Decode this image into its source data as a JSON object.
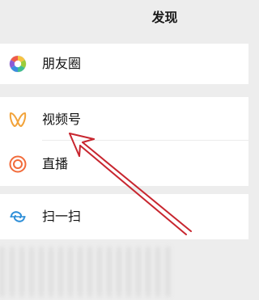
{
  "header": {
    "title": "发现"
  },
  "menu": {
    "moments": {
      "label": "朋友圈",
      "icon": "moments-aperture-icon"
    },
    "channels": {
      "label": "视频号",
      "icon": "channels-butterfly-icon"
    },
    "live": {
      "label": "直播",
      "icon": "live-concentric-circle-icon"
    },
    "scan": {
      "label": "扫一扫",
      "icon": "scan-icon"
    }
  },
  "annotation": {
    "color": "#c8262f",
    "points_to": "视频号"
  },
  "colors": {
    "page_background": "#ededed",
    "card_background": "#ffffff",
    "channels_orange": "#f2a33a",
    "live_orange": "#f26b3a",
    "scan_blue": "#2f8fd8"
  }
}
